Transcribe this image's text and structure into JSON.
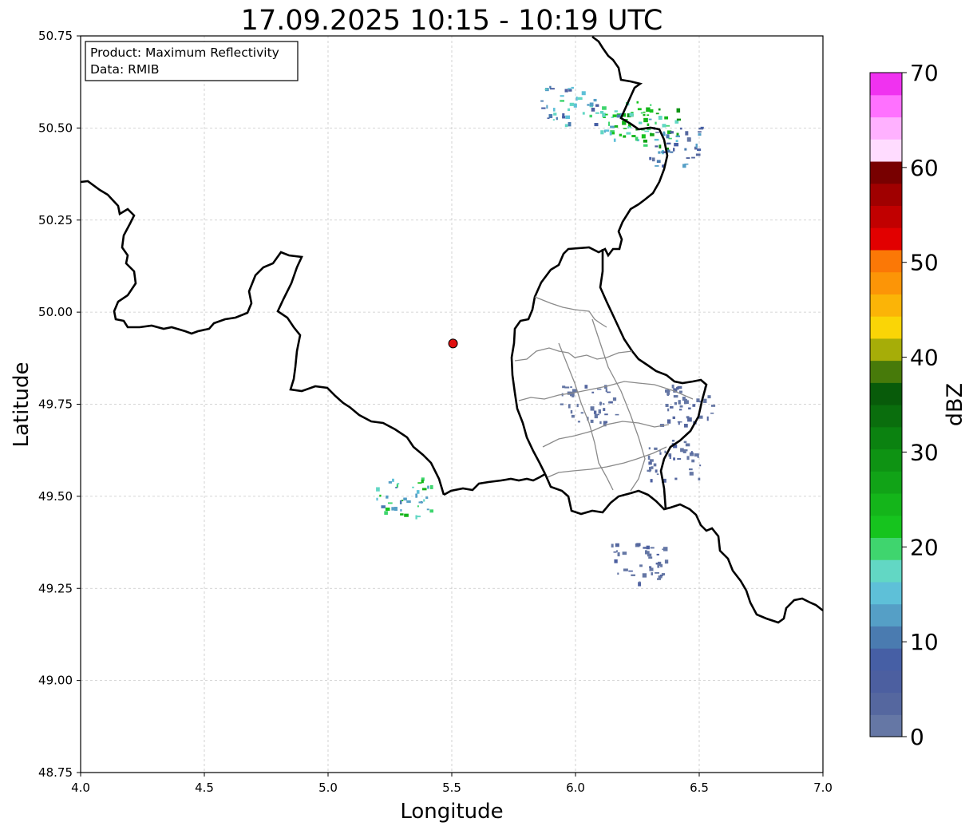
{
  "title": "17.09.2025 10:15 - 10:19 UTC",
  "info_box": {
    "product_line": "Product: Maximum Reflectivity",
    "data_line": "Data: RMIB"
  },
  "axes": {
    "xlabel": "Longitude",
    "ylabel": "Latitude",
    "xlim": [
      4.0,
      7.0
    ],
    "ylim": [
      48.75,
      50.75
    ],
    "xticks": [
      "4.0",
      "4.5",
      "5.0",
      "5.5",
      "6.0",
      "6.5",
      "7.0"
    ],
    "yticks": [
      "48.75",
      "49.00",
      "49.25",
      "49.50",
      "49.75",
      "50.00",
      "50.25",
      "50.50",
      "50.75"
    ],
    "grid": true
  },
  "colorbar": {
    "label": "dBZ",
    "range": [
      0,
      70
    ],
    "ticks": [
      "0",
      "10",
      "20",
      "30",
      "40",
      "50",
      "60",
      "70"
    ],
    "colors": [
      "#6577a5",
      "#55679f",
      "#4c5fa0",
      "#465fa5",
      "#4a7bb0",
      "#559fc6",
      "#5ec0d8",
      "#62d7c4",
      "#3fd56e",
      "#16c41e",
      "#14b51a",
      "#11a317",
      "#0e9313",
      "#0b8210",
      "#0a6e0d",
      "#085b0a",
      "#477a0a",
      "#a6ad08",
      "#fad506",
      "#fbb407",
      "#fc9507",
      "#fb7806",
      "#e20000",
      "#c10000",
      "#a00000",
      "#780000",
      "#ffdcff",
      "#ffb1ff",
      "#ff71ff",
      "#f032f0"
    ]
  },
  "radar_site": {
    "lon": 5.505,
    "lat": 49.915,
    "color": "#e01010"
  },
  "chart_data": {
    "type": "map",
    "title": "17.09.2025 10:15 - 10:19 UTC",
    "xlabel": "Longitude",
    "ylabel": "Latitude",
    "xlim": [
      4.0,
      7.0
    ],
    "ylim": [
      48.75,
      50.75
    ],
    "colorbar_label": "dBZ",
    "colorbar_range": [
      0,
      70
    ],
    "grid": true,
    "echoes": [
      {
        "lon": 5.97,
        "lat": 50.56,
        "dbz": 20
      },
      {
        "lon": 6.2,
        "lat": 50.52,
        "dbz": 25
      },
      {
        "lon": 6.3,
        "lat": 50.5,
        "dbz": 30
      },
      {
        "lon": 6.4,
        "lat": 50.45,
        "dbz": 15
      },
      {
        "lon": 6.25,
        "lat": 49.32,
        "dbz": 5
      },
      {
        "lon": 6.05,
        "lat": 49.75,
        "dbz": 5
      },
      {
        "lon": 6.45,
        "lat": 49.75,
        "dbz": 5
      },
      {
        "lon": 5.3,
        "lat": 49.5,
        "dbz": 25
      },
      {
        "lon": 6.4,
        "lat": 49.6,
        "dbz": 5
      }
    ]
  }
}
